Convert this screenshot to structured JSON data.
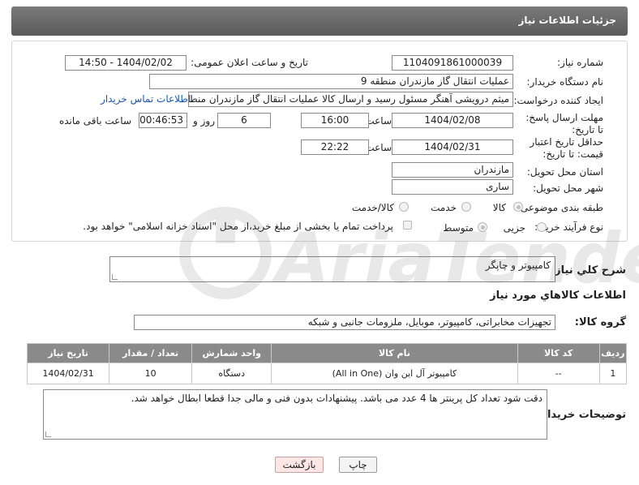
{
  "header": {
    "title": "جزئیات اطلاعات نیاز"
  },
  "labels": {
    "need_number": "شماره نیاز:",
    "announce_datetime": "تاریخ و ساعت اعلان عمومی:",
    "buyer_org": "نام دستگاه خریدار:",
    "creator": "ایجاد کننده درخواست:",
    "reply_deadline": "مهلت ارسال پاسخ: تا تاریخ:",
    "price_validity": "حداقل تاریخ اعتبار قیمت: تا تاریخ:",
    "time": "ساعت",
    "time2": "ساعت",
    "days_and": "روز و",
    "remaining": "ساعت باقی مانده",
    "province": "استان محل تحویل:",
    "city": "شهر محل تحویل:",
    "category": "طبقه بندی موضوعی:",
    "purchase_type": "نوع فرآیند خرید :",
    "summary": "شرح کلي نياز:",
    "goods_info": "اطلاعات کالاهاي مورد نياز",
    "goods_group": "گروه کالا:",
    "buyer_notes": "توضیحات خریدار:"
  },
  "fields": {
    "need_number": "1104091861000039",
    "announce_datetime": "1404/02/02 - 14:50",
    "buyer_org": "عملیات انتقال گاز مازندران منطقه 9",
    "creator": "میثم درویشی آهنگر مسئول رسید و ارسال کالا عملیات انتقال گاز مازندران منطقه 9",
    "contact_link": "اطلاعات تماس خریدار",
    "reply_date": "1404/02/08",
    "reply_time": "16:00",
    "reply_days": "6",
    "reply_remaining": "00:46:53",
    "price_date": "1404/02/31",
    "price_time": "22:22",
    "province": "مازندران",
    "city": "ساری",
    "summary": "کامپیوتر و چاپگر",
    "goods_group": "تجهیزات مخابراتی، کامپیوتر، موبایل، ملزومات جانبی و شبکه",
    "buyer_notes": "دقت شود تعداد کل پرینتر ها 4 عدد می باشد. پیشنهادات بدون فنی و مالی جدا قطعا ابطال خواهد شد."
  },
  "category_options": {
    "goods": "کالا",
    "service": "خدمت",
    "goods_service": "کالا/خدمت"
  },
  "purchase_options": {
    "partial": "جزیی",
    "medium": "متوسط",
    "treasury_note": "پرداخت تمام یا بخشی از مبلغ خرید،از محل \"اسناد خزانه اسلامی\" خواهد بود."
  },
  "table": {
    "headers": [
      "ردیف",
      "کد کالا",
      "نام کالا",
      "واحد شمارش",
      "تعداد / مقدار",
      "تاریخ نیاز"
    ],
    "rows": [
      [
        "1",
        "--",
        "کامپیوتر آل این وان (All in One)",
        "دستگاه",
        "10",
        "1404/02/31"
      ]
    ]
  },
  "buttons": {
    "print": "چاپ",
    "back": "بازگشت"
  },
  "watermark": {
    "text": "AriaTender.neT"
  }
}
